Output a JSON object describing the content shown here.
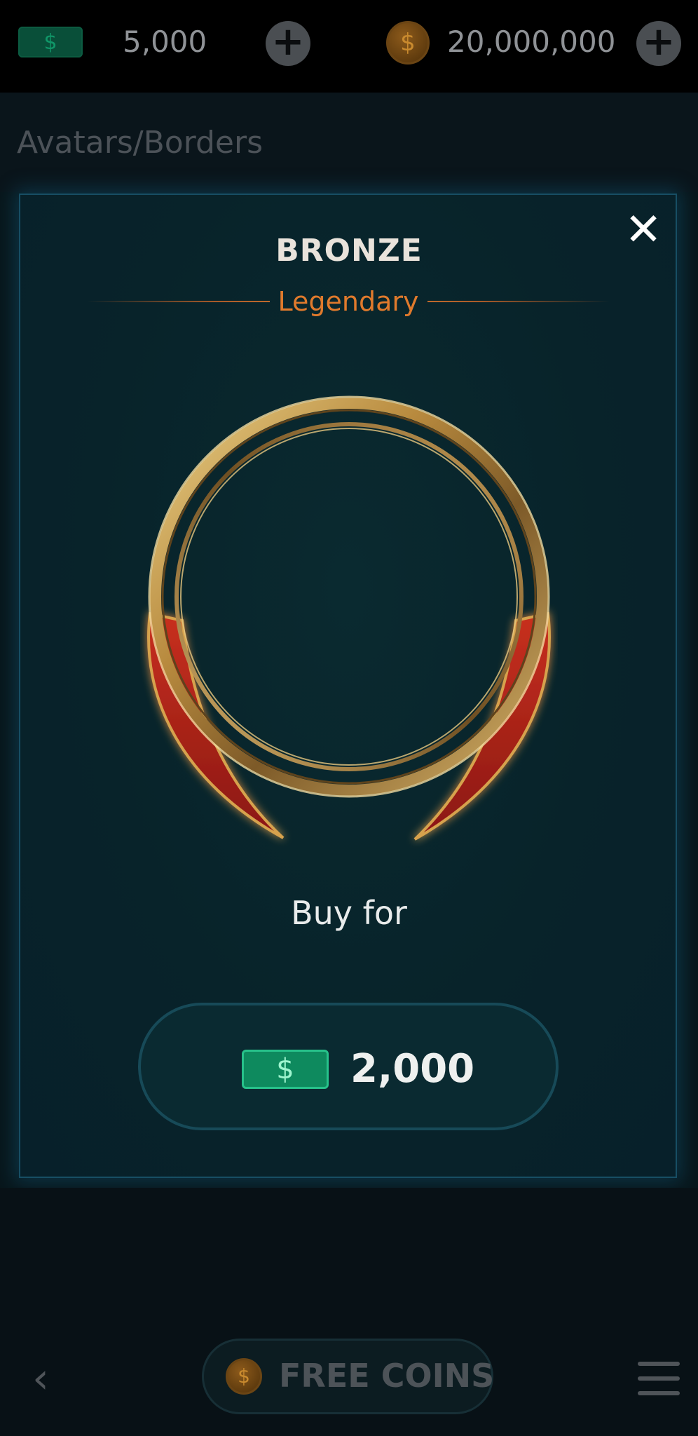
{
  "topbar": {
    "cash_icon": "dollar-bill-icon",
    "cash_symbol": "$",
    "cash_value": "5,000",
    "add_cash_symbol": "+",
    "coin_icon": "gold-coin-icon",
    "coin_symbol": "$",
    "coin_value": "20,000,000",
    "add_coins_symbol": "+"
  },
  "page": {
    "heading": "Avatars/Borders"
  },
  "modal": {
    "title": "BRONZE",
    "rarity": "Legendary",
    "close_symbol": "✕",
    "buy_label": "Buy for",
    "price_icon": "dollar-bill-icon",
    "price_symbol": "$",
    "price_value": "2,000",
    "colors": {
      "rarity": "#e07a2c",
      "frame_gold": "#c9a25a",
      "ribbon_red": "#b4231f",
      "price_cash": "#0e8a5e"
    }
  },
  "bottombar": {
    "back_symbol": "‹",
    "free_coins_icon": "gold-coin-icon",
    "free_coins_symbol": "$",
    "free_coins_label": "FREE COINS",
    "menu_icon": "hamburger-menu-icon"
  }
}
